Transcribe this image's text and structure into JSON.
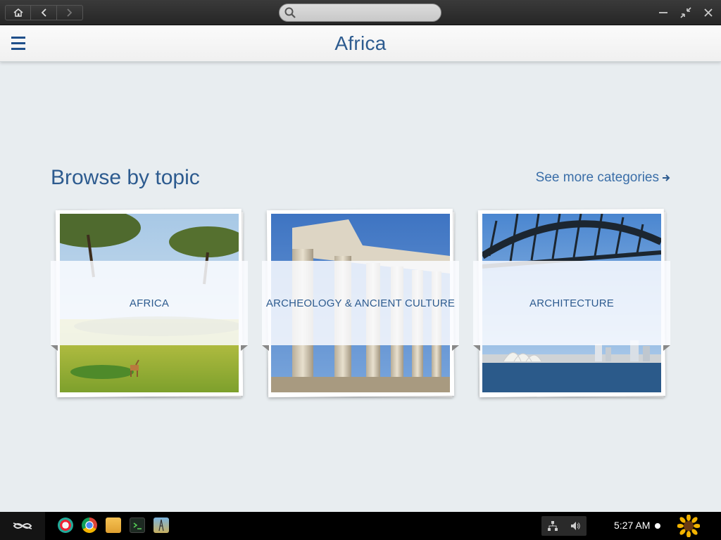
{
  "search": {
    "placeholder": "",
    "value": ""
  },
  "header": {
    "title": "Africa",
    "menu_icon": "hamburger-icon"
  },
  "main": {
    "section_title": "Browse by topic",
    "see_more_label": "See more categories",
    "cards": [
      {
        "label": "AFRICA"
      },
      {
        "label": "ARCHEOLOGY & ANCIENT CULTURE"
      },
      {
        "label": "ARCHITECTURE"
      }
    ]
  },
  "taskbar": {
    "apps": [
      "app-store-icon",
      "chrome-icon",
      "files-icon",
      "terminal-icon",
      "encyclopedia-icon"
    ],
    "clock": "5:27 AM"
  },
  "colors": {
    "accent": "#2d5b8f",
    "link": "#3a6ea8",
    "background": "#e8edf0"
  }
}
